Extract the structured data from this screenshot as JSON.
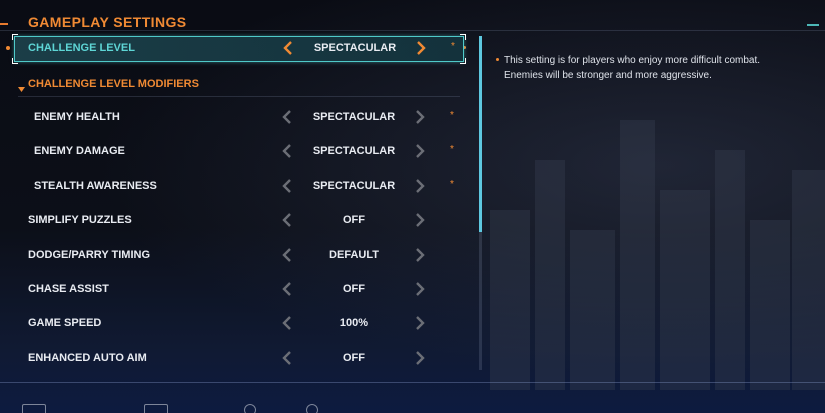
{
  "page": {
    "title": "GAMEPLAY SETTINGS"
  },
  "colors": {
    "accent": "#f08a34",
    "highlight": "#5ed6d6",
    "text": "#e9ecf2"
  },
  "selected": {
    "label": "CHALLENGE LEVEL",
    "value": "SPECTACULAR",
    "modified": "*"
  },
  "section": {
    "label": "CHALLENGE LEVEL MODIFIERS"
  },
  "rows": [
    {
      "label": "ENEMY HEALTH",
      "value": "SPECTACULAR",
      "modified": "*"
    },
    {
      "label": "ENEMY DAMAGE",
      "value": "SPECTACULAR",
      "modified": "*"
    },
    {
      "label": "STEALTH AWARENESS",
      "value": "SPECTACULAR",
      "modified": "*"
    },
    {
      "label": "SIMPLIFY PUZZLES",
      "value": "OFF",
      "modified": ""
    },
    {
      "label": "DODGE/PARRY TIMING",
      "value": "DEFAULT",
      "modified": ""
    },
    {
      "label": "CHASE ASSIST",
      "value": "OFF",
      "modified": ""
    },
    {
      "label": "GAME SPEED",
      "value": "100%",
      "modified": ""
    },
    {
      "label": "ENHANCED AUTO AIM",
      "value": "OFF",
      "modified": ""
    }
  ],
  "description": {
    "text": "This setting is for players who enjoy more difficult combat. Enemies will be stronger and more aggressive."
  },
  "icons": {
    "arrow_left": "chevron-left-icon",
    "arrow_right": "chevron-right-icon",
    "section_caret": "caret-down-icon"
  }
}
